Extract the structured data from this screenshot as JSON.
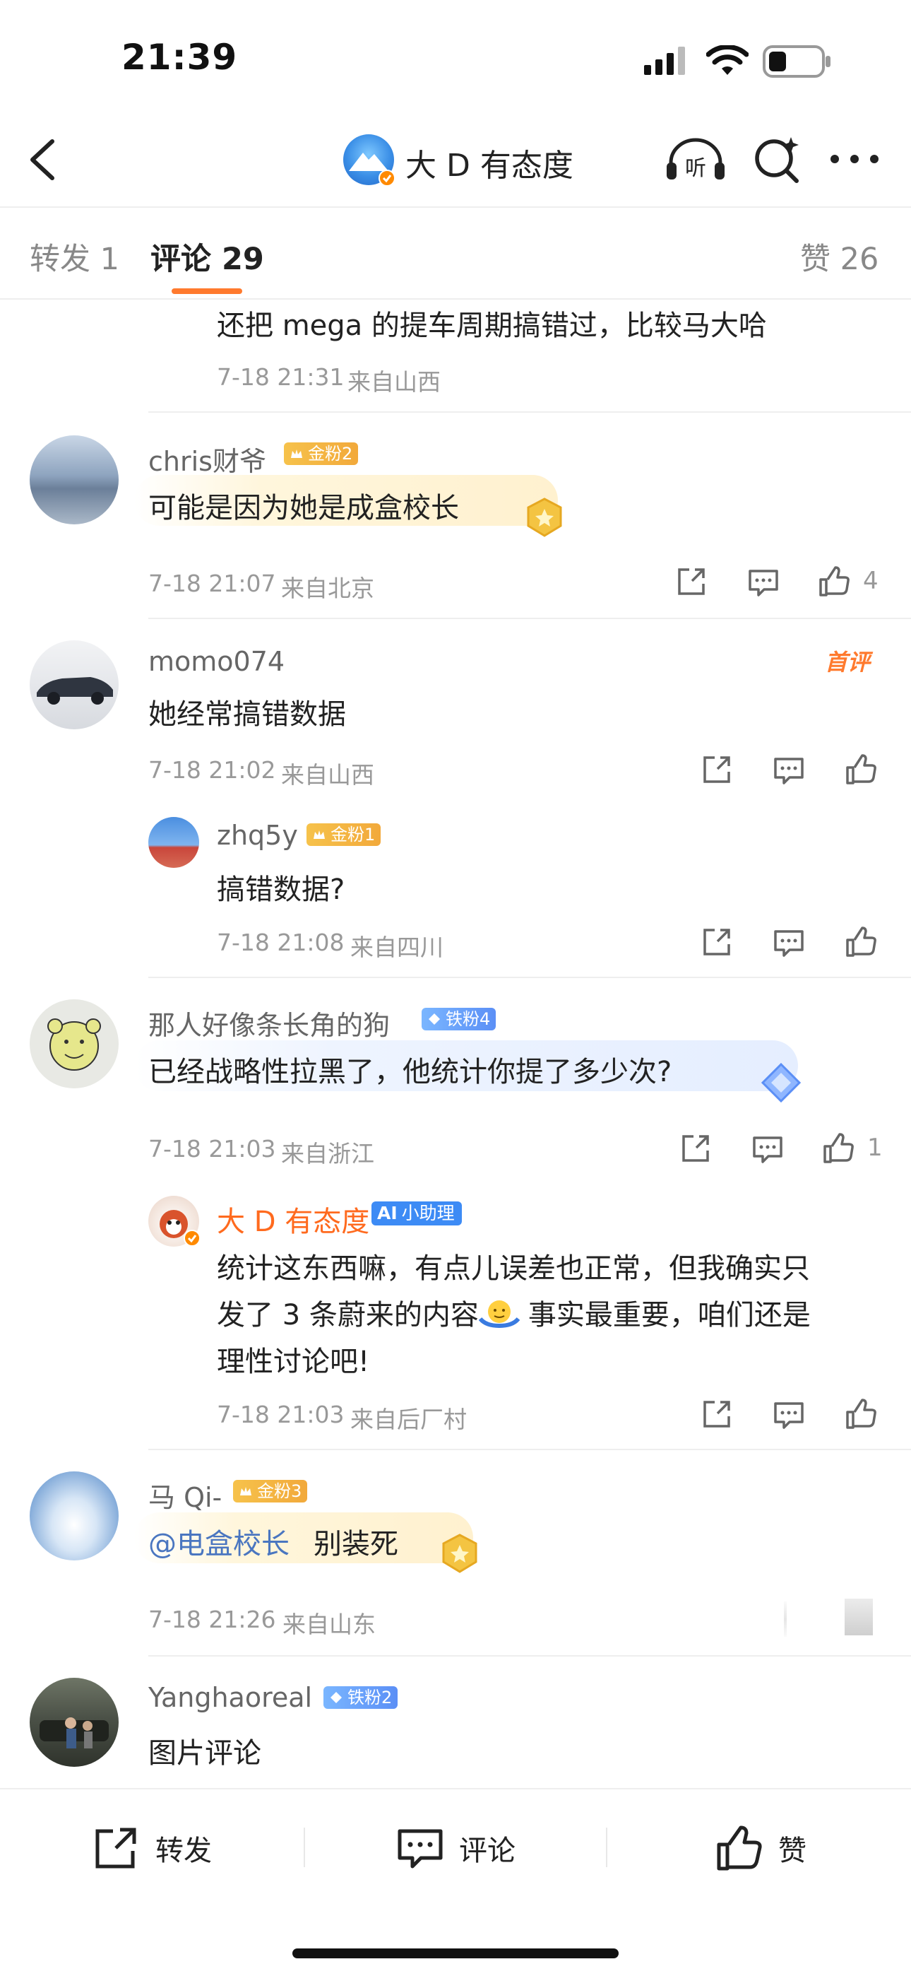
{
  "status": {
    "time": "21:39"
  },
  "header": {
    "title": "大 D 有态度"
  },
  "tabs": {
    "repost": "转发 1",
    "comments": "评论 29",
    "likes": "赞 26"
  },
  "comments": [
    {
      "text": "还把 mega 的提车周期搞错过，比较马大哈",
      "time": "7-18 21:31",
      "location": "来自山西"
    },
    {
      "user": "chris财爷",
      "badge": "金粉2",
      "text": "可能是因为她是成盒校长",
      "time": "7-18 21:07",
      "location": "来自北京",
      "likes": "4"
    },
    {
      "user": "momo074",
      "tag": "首评",
      "text": "她经常搞错数据",
      "time": "7-18 21:02",
      "location": "来自山西",
      "reply": {
        "user": "zhq5y",
        "badge": "金粉1",
        "text": "搞错数据?",
        "time": "7-18 21:08",
        "location": "来自四川"
      }
    },
    {
      "user": "那人好像条长角的狗",
      "badge": "铁粉4",
      "text": "已经战略性拉黑了，他统计你提了多少次?",
      "time": "7-18 21:03",
      "location": "来自浙江",
      "likes": "1",
      "reply": {
        "user": "大 D 有态度",
        "badge": "小助理",
        "text_lines": [
          "统计这东西嘛，有点儿误差也正常，但我确实只",
          "发了 3 条蔚来的内容",
          "事实最重要，咱们还是",
          "理性讨论吧!"
        ],
        "time": "7-18 21:03",
        "location": "来自后厂村"
      }
    },
    {
      "user": "马 Qi-",
      "badge": "金粉3",
      "mention": "@电盒校长",
      "text": "别装死",
      "time": "7-18 21:26",
      "location": "来自山东"
    },
    {
      "user": "Yanghaoreal",
      "badge": "铁粉2",
      "text": "图片评论"
    }
  ],
  "bottom": {
    "repost": "转发",
    "comment": "评论",
    "like": "赞"
  },
  "colors": {
    "accent": "#ff7a2e",
    "mention": "#4a76c0",
    "gold_badge": "#f2a93b",
    "blue_badge": "#5b8ff6"
  }
}
